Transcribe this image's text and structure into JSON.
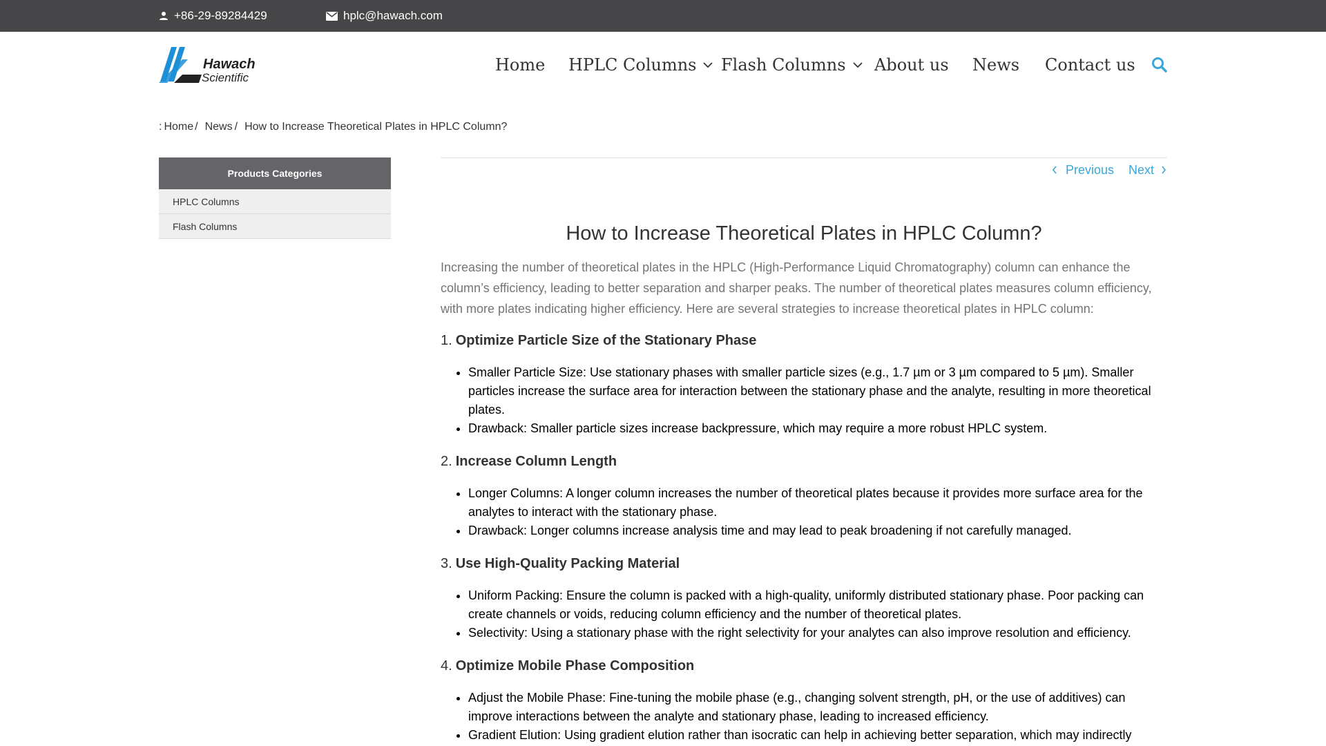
{
  "topbar": {
    "phone_icon": "person-icon",
    "phone": "+86-29-89284429",
    "email_icon": "mail-icon",
    "email": "hplc@hawach.com"
  },
  "logo": {
    "line1": "Hawach",
    "line2": "Scientific"
  },
  "nav": {
    "home": "Home",
    "hplc": "HPLC Columns",
    "flash": "Flash Columns",
    "about": "About us",
    "news": "News",
    "contact": "Contact us",
    "search_icon": "search-icon"
  },
  "breadcrumb": {
    "prefix": ":",
    "home": "Home",
    "sep1": "/",
    "news": "News",
    "sep2": "/",
    "current": "How to Increase Theoretical Plates in HPLC Column?"
  },
  "sidebar": {
    "heading": "Products Categories",
    "items": [
      "HPLC Columns",
      "Flash Columns"
    ]
  },
  "pager": {
    "previous": "Previous",
    "next": "Next"
  },
  "article": {
    "title": "How to Increase Theoretical Plates in HPLC Column?",
    "intro": "Increasing the number of theoretical plates in the HPLC (High-Performance Liquid Chromatography) column can enhance the column’s efficiency, leading to better separation and sharper peaks. The number of theoretical plates measures column efficiency, with more plates indicating higher efficiency. Here are several strategies to increase theoretical plates in HPLC column:",
    "sections": [
      {
        "num": "1.",
        "heading": "Optimize Particle Size of the Stationary Phase",
        "bullets": [
          "Smaller Particle Size: Use stationary phases with smaller particle sizes (e.g., 1.7 µm or 3 µm compared to 5 µm). Smaller particles increase the surface area for interaction between the stationary phase and the analyte, resulting in more theoretical plates.",
          "Drawback: Smaller particle sizes increase backpressure, which may require a more robust HPLC system."
        ]
      },
      {
        "num": "2.",
        "heading": "Increase Column Length",
        "bullets": [
          "Longer Columns: A longer column increases the number of theoretical plates because it provides more surface area for the analytes to interact with the stationary phase.",
          "Drawback: Longer columns increase analysis time and may lead to peak broadening if not carefully managed."
        ]
      },
      {
        "num": "3.",
        "heading": "Use High-Quality Packing Material",
        "bullets": [
          "Uniform Packing: Ensure the column is packed with a high-quality, uniformly distributed stationary phase. Poor packing can create channels or voids, reducing column efficiency and the number of theoretical plates.",
          "Selectivity: Using a stationary phase with the right selectivity for your analytes can also improve resolution and efficiency."
        ]
      },
      {
        "num": "4.",
        "heading": "Optimize Mobile Phase Composition",
        "bullets": [
          "Adjust the Mobile Phase: Fine-tuning the mobile phase (e.g., changing solvent strength, pH, or the use of additives) can improve interactions between the analyte and stationary phase, leading to increased efficiency.",
          "Gradient Elution: Using gradient elution rather than isocratic can help in achieving better separation, which may indirectly"
        ]
      }
    ]
  },
  "colors": {
    "topbar": "#464649",
    "accent": "#3aa7d8",
    "sidebar_head": "#646469",
    "logo_blue": "#1d8fd6"
  }
}
